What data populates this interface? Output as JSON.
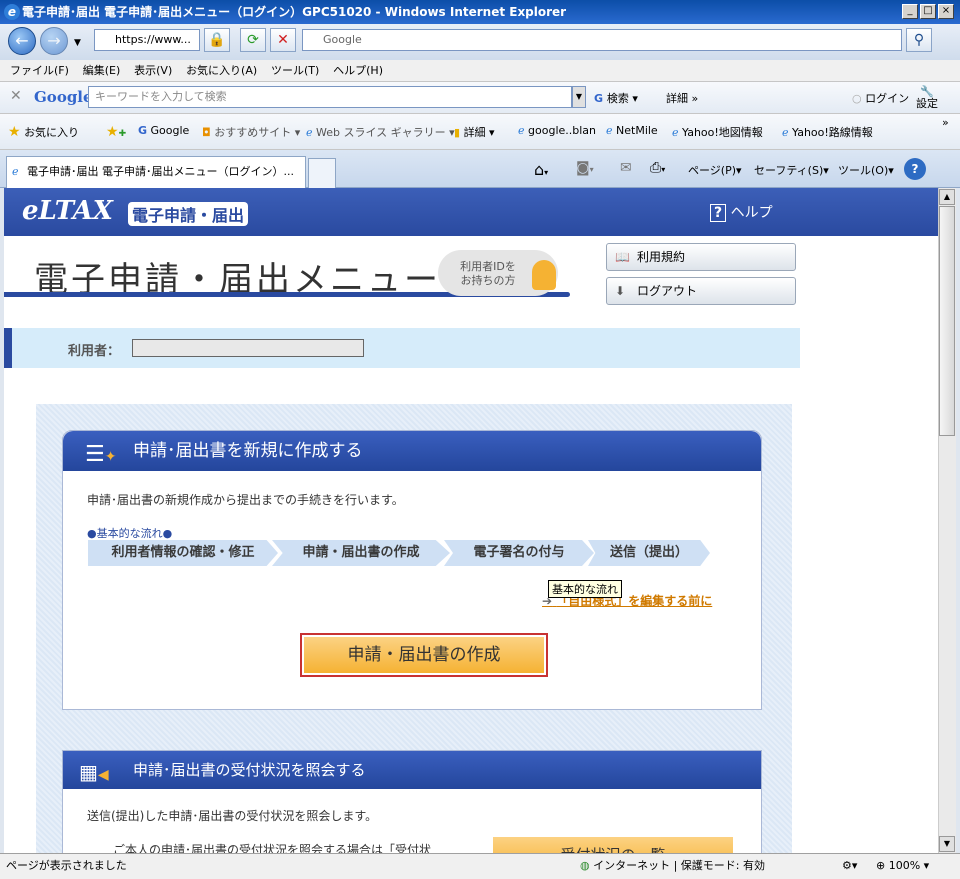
{
  "window": {
    "title": "電子申請･届出 電子申請･届出メニュー（ログイン）GPC51020 - Windows Internet Explorer",
    "min": "_",
    "max": "□",
    "close": "×"
  },
  "nav": {
    "address": "https://www...",
    "search_placeholder": "Google",
    "back_arrow": "←",
    "forward_arrow": "→"
  },
  "menu": [
    "ファイル(F)",
    "編集(E)",
    "表示(V)",
    "お気に入り(A)",
    "ツール(T)",
    "ヘルプ(H)"
  ],
  "google_toolbar": {
    "logo": "Google",
    "placeholder": "キーワードを入力して検索",
    "search_btn": "検索",
    "details": "詳細 »",
    "login": "ログイン",
    "settings": "設定"
  },
  "favorites": {
    "label": "お気に入り",
    "items": [
      "Google",
      "おすすめサイト",
      "Web スライス ギャラリー",
      "詳細",
      "google..blan",
      "NetMile",
      "Yahoo!地図情報",
      "Yahoo!路線情報"
    ]
  },
  "tab": {
    "label": "電子申請･届出 電子申請･届出メニュー（ログイン）...",
    "page_menu": "ページ(P)",
    "safety_menu": "セーフティ(S)",
    "tools_menu": "ツール(O)"
  },
  "site": {
    "logo": "eLTAX",
    "logo_sub": "電子申請・届出",
    "help": "ヘルプ",
    "page_title": "電子申請・届出メニュー",
    "id_badge_line1": "利用者IDを",
    "id_badge_line2": "お持ちの方",
    "terms_btn": "利用規約",
    "logout_btn": "ログアウト",
    "user_label": "利用者："
  },
  "section1": {
    "title": "申請･届出書を新規に作成する",
    "desc": "申請･届出書の新規作成から提出までの手続きを行います。",
    "flow_label": "●基本的な流れ●",
    "steps": [
      "利用者情報の確認・修正",
      "申請・届出書の作成",
      "電子署名の付与",
      "送信（提出）"
    ],
    "tooltip": "基本的な流れ",
    "link": "「自由様式」を編集する前に",
    "create_btn": "申請・届出書の作成"
  },
  "section2": {
    "title": "申請･届出書の受付状況を照会する",
    "desc": "送信(提出)した申請･届出書の受付状況を照会します。",
    "desc2": "ご本人の申請･届出書の受付状況を照会する場合は「受付状",
    "btn": "受付状況の一覧"
  },
  "statusbar": {
    "text": "ページが表示されました",
    "zone": "インターネット | 保護モード: 有効",
    "zoom": "100%"
  },
  "colors": {
    "brand_blue": "#2a4aa0",
    "accent_orange": "#f5b233",
    "button_border": "#c83232"
  }
}
